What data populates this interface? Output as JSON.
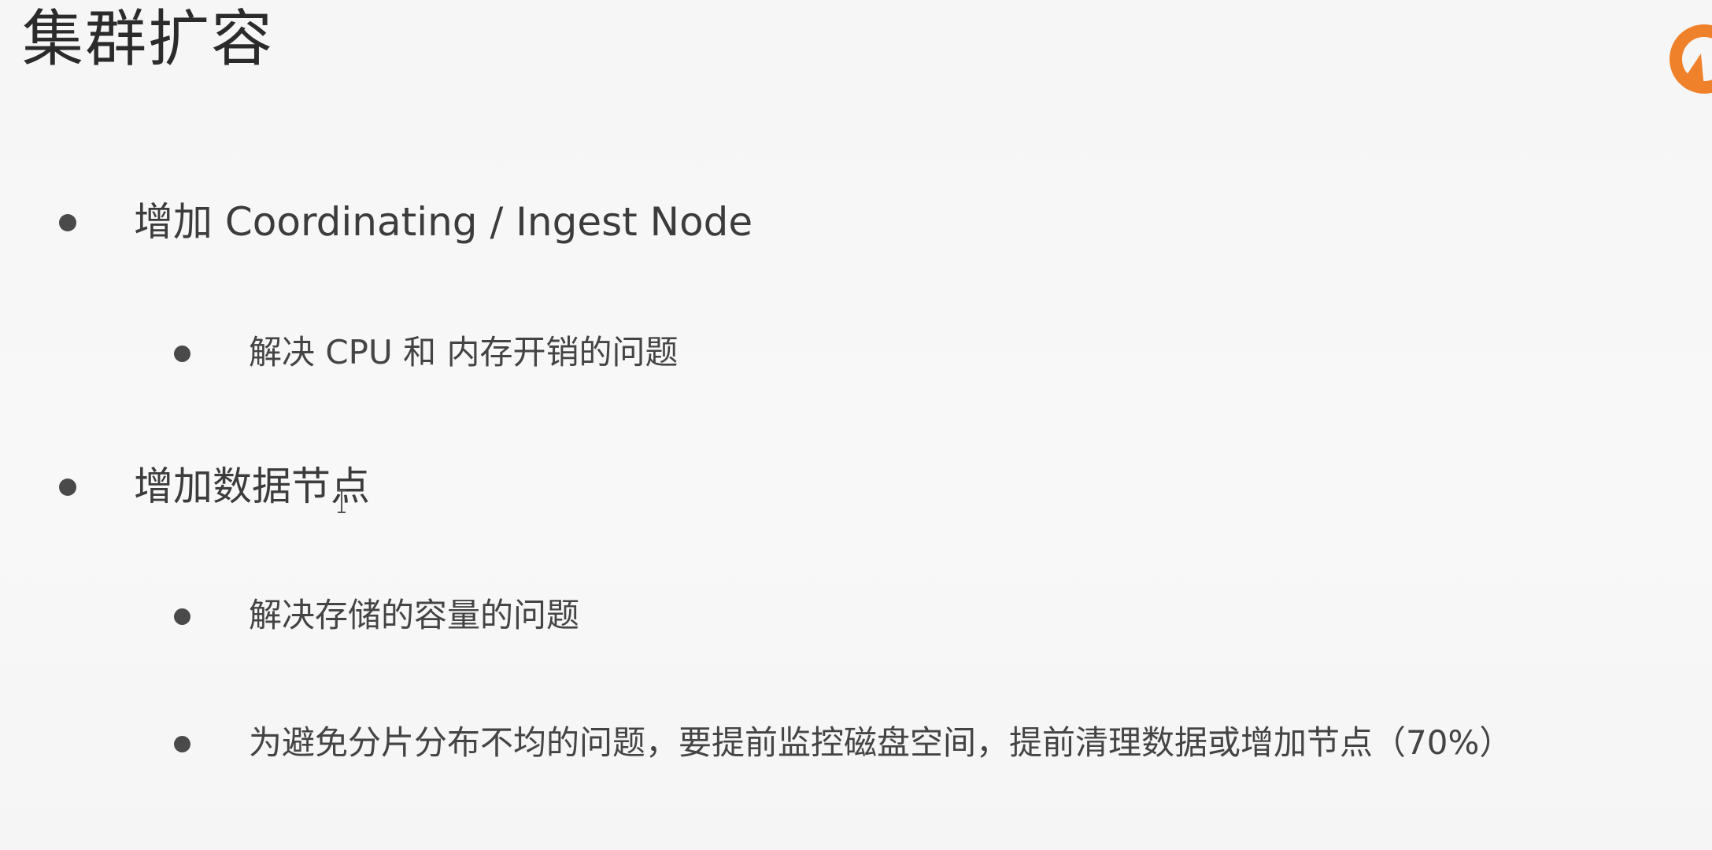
{
  "slide": {
    "title": "集群扩容",
    "logo_icon": "orange-circular-logo-icon",
    "bullets": [
      {
        "text": "增加 Coordinating / Ingest Node"
      },
      {
        "text": "解决 CPU 和 内存开销的问题"
      },
      {
        "text": "增加数据节点"
      },
      {
        "text": "解决存储的容量的问题"
      },
      {
        "text": "为避免分片分布不均的问题，要提前监控磁盘空间，提前清理数据或增加节点（70%）"
      }
    ]
  },
  "colors": {
    "background": "#f7f7f7",
    "text": "#3c3c3c",
    "logo_accent": "#f0812b"
  }
}
